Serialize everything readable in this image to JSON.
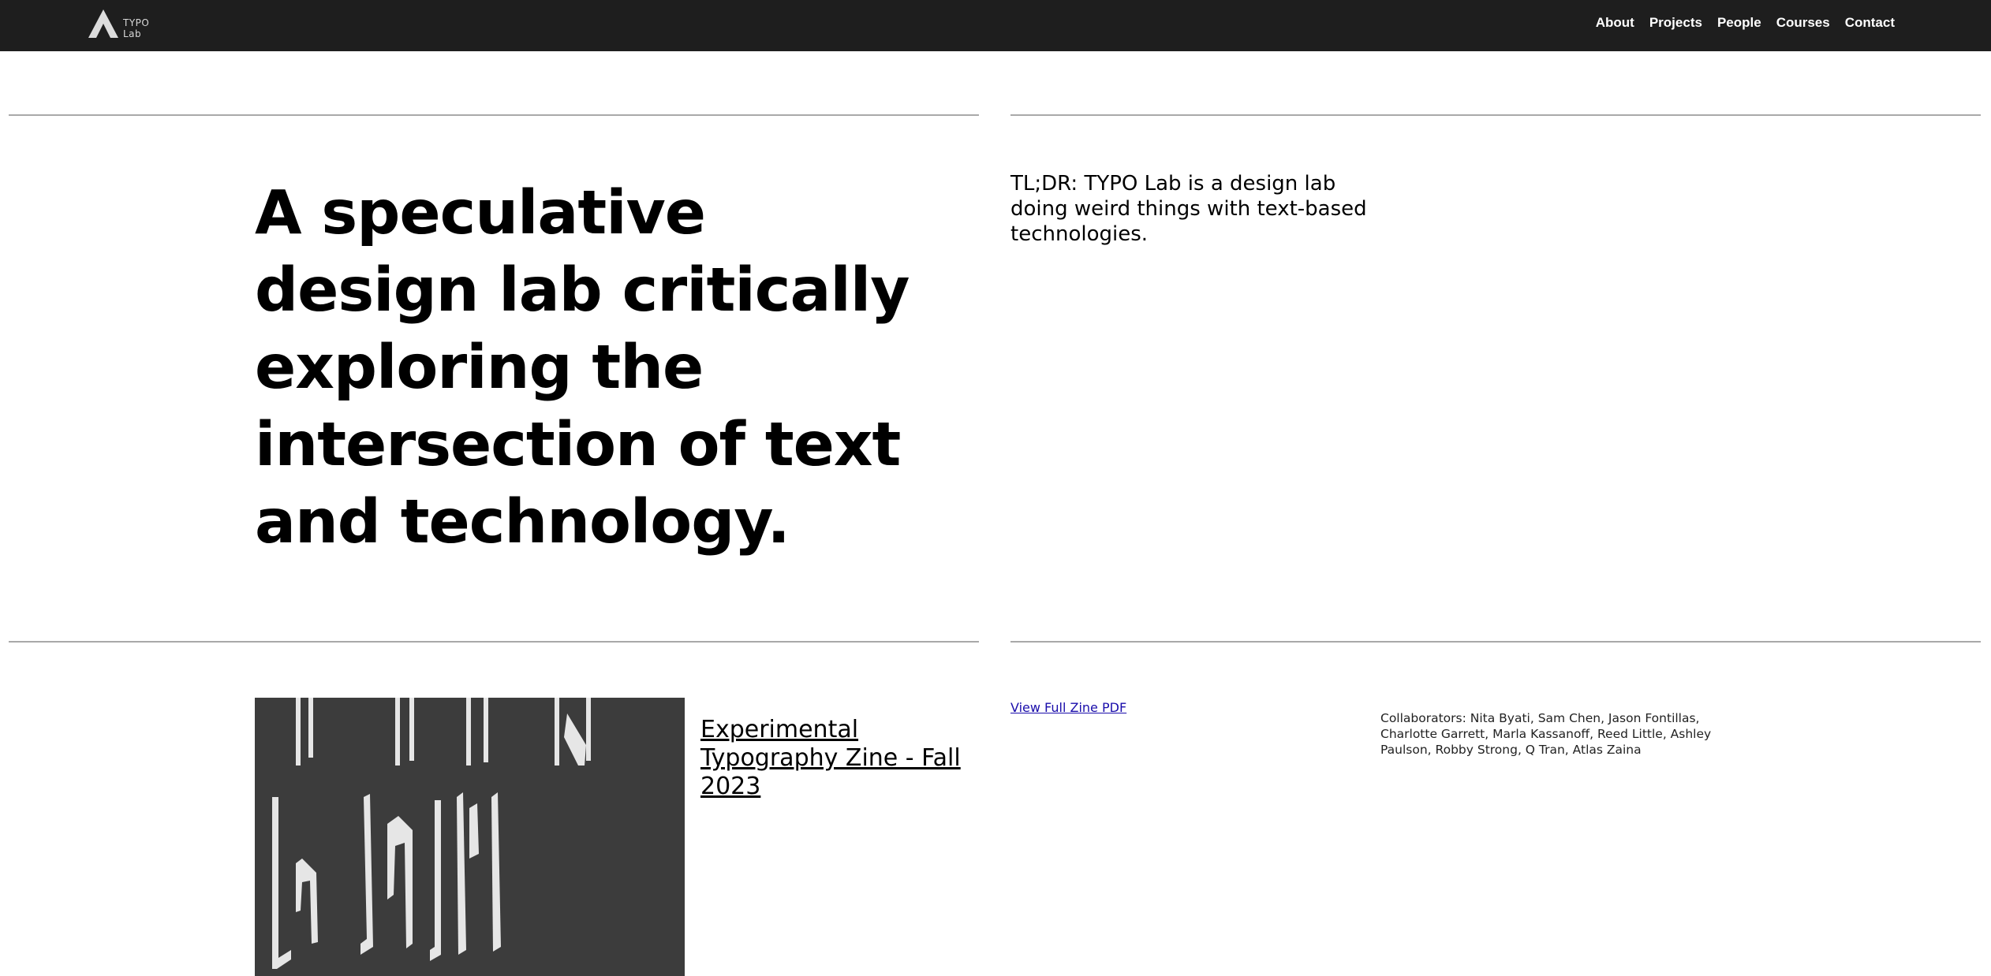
{
  "header": {
    "logo_text_line1": "TYPO",
    "logo_text_line2": "Lab",
    "nav": [
      {
        "label": "About"
      },
      {
        "label": "Projects"
      },
      {
        "label": "People"
      },
      {
        "label": "Courses"
      },
      {
        "label": "Contact"
      }
    ]
  },
  "hero": {
    "title": "A speculative design lab critically exploring the intersection of text and technology.",
    "tldr": "TL;DR: TYPO Lab is a design lab doing weird things with text-based technologies."
  },
  "zine": {
    "title": "Experimental Typography Zine - Fall 2023",
    "pdf_link": "View Full Zine PDF",
    "collaborators": "Collaborators: Nita Byati, Sam Chen, Jason Fontillas, Charlotte Garrett, Marla Kassanoff, Reed Little, Ashley Paulson, Robby Strong, Q Tran, Atlas Zaina"
  },
  "colors": {
    "header_bg": "#1e1e1e",
    "rule": "#a9a9a9",
    "link": "#1a0dab",
    "zine_bg": "#3c3c3c"
  }
}
